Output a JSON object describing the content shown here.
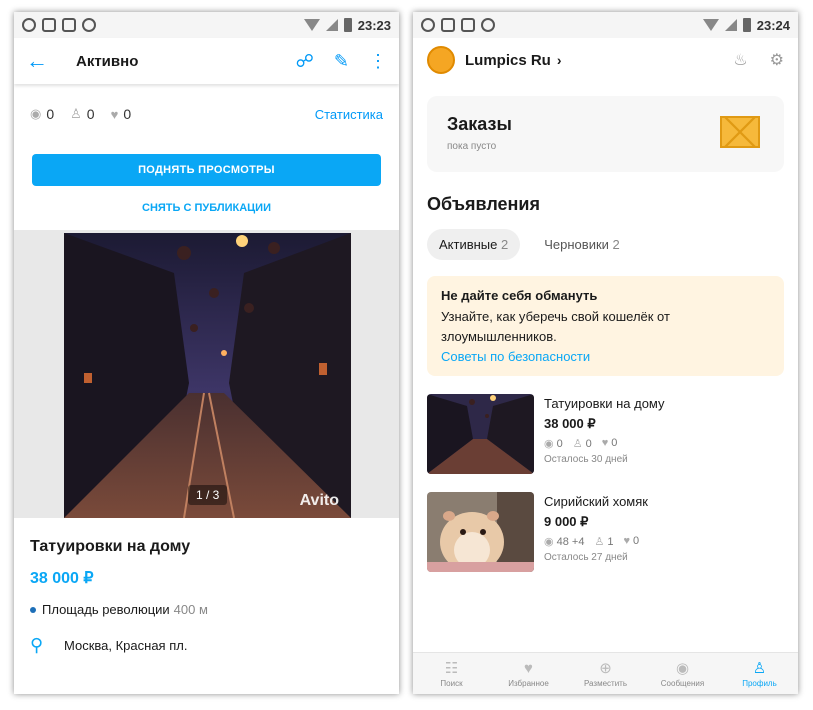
{
  "left": {
    "status": {
      "time": "23:23"
    },
    "topbar": {
      "title": "Активно"
    },
    "stats": {
      "views": "0",
      "contacts": "0",
      "favorites": "0",
      "link": "Статистика"
    },
    "buttons": {
      "raise": "ПОДНЯТЬ ПРОСМОТРЫ",
      "unpublish": "СНЯТЬ С ПУБЛИКАЦИИ"
    },
    "gallery": {
      "counter": "1 / 3",
      "watermark": "Avito"
    },
    "ad": {
      "title": "Татуировки на дому",
      "price": "38 000 ₽",
      "metro": "Площадь революции",
      "metro_distance": "400 м",
      "address": "Москва, Красная пл."
    }
  },
  "right": {
    "status": {
      "time": "23:24"
    },
    "profile": {
      "name": "Lumpics Ru"
    },
    "orders": {
      "title": "Заказы",
      "subtitle": "пока пусто"
    },
    "section_title": "Объявления",
    "tabs": [
      {
        "label": "Активные",
        "count": "2"
      },
      {
        "label": "Черновики",
        "count": "2"
      }
    ],
    "warning": {
      "title": "Не дайте себя обмануть",
      "text": "Узнайте, как уберечь свой кошелёк от злоумышленников.",
      "link": "Советы по безопасности"
    },
    "listings": [
      {
        "title": "Татуировки на дому",
        "price": "38 000 ₽",
        "views": "0",
        "contacts": "0",
        "favorites": "0",
        "remaining": "Осталось 30 дней"
      },
      {
        "title": "Сирийский хомяк",
        "price": "9 000 ₽",
        "views": "48 +4",
        "contacts": "1",
        "favorites": "0",
        "remaining": "Осталось 27 дней"
      }
    ],
    "nav": [
      {
        "label": "Поиск"
      },
      {
        "label": "Избранное"
      },
      {
        "label": "Разместить"
      },
      {
        "label": "Сообщения"
      },
      {
        "label": "Профиль"
      }
    ]
  },
  "colors": {
    "accent": "#0aa7f5",
    "warning_bg": "#fff4e1"
  }
}
